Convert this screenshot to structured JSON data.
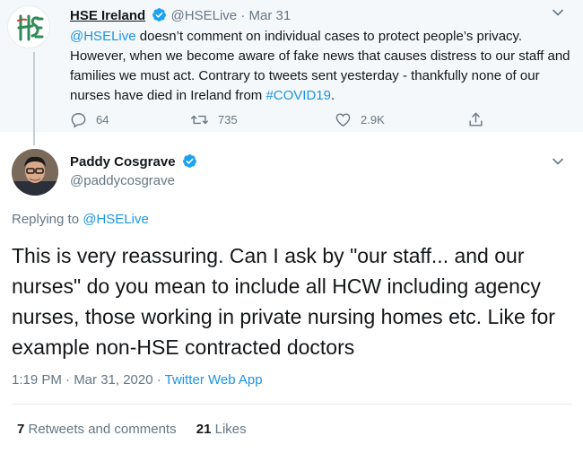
{
  "parent_tweet": {
    "author_name": "HSE Ireland",
    "author_handle": "@HSELive",
    "date": "Mar 31",
    "text_mention": "@HSELive",
    "text_body": " doesn’t comment on individual cases to protect people’s privacy. However, when we become aware of fake news that causes distress to our staff and families we must act. Contrary to tweets sent yesterday - thankfully none of our nurses have died in Ireland from ",
    "text_hashtag": "#COVID19",
    "text_end": ".",
    "replies": "64",
    "retweets": "735",
    "likes": "2.9K",
    "icons": [
      "reply-icon",
      "retweet-icon",
      "like-icon",
      "share-icon"
    ]
  },
  "main_tweet": {
    "author_name": "Paddy Cosgrave",
    "author_handle": "@paddycosgrave",
    "replying_prefix": "Replying to ",
    "replying_handle": "@HSELive",
    "text": "This is very reassuring. Can I ask by \"our staff... and our nurses\" do you mean to include all HCW including agency nurses, those working in private nursing homes etc. Like for example non-HSE contracted doctors",
    "timestamp": "1:19 PM · Mar 31, 2020 · ",
    "source": "Twitter Web App",
    "retweets_count": "7",
    "retweets_label": " Retweets and comments",
    "likes_count": "21",
    "likes_label": " Likes"
  },
  "colors": {
    "link": "#1b95e0",
    "verified": "#1da1f2",
    "muted": "#657786",
    "hse_green": "#2e8b57"
  }
}
